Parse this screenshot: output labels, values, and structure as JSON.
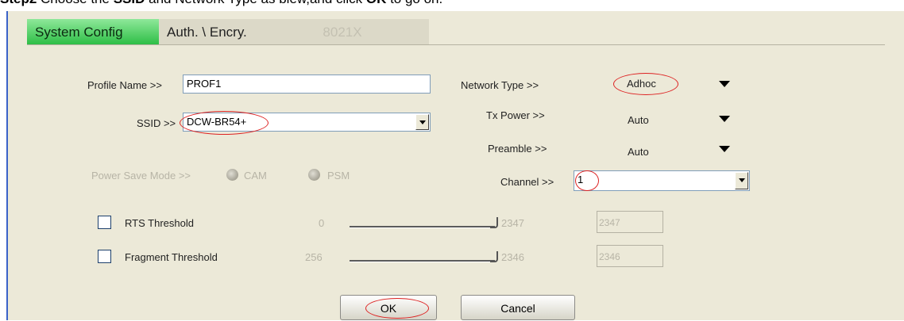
{
  "caption": {
    "step": "Step2",
    "text1": " Choose the ",
    "ssid": "SSID",
    "text2": " and Network Type as blew,and click ",
    "ok": "OK",
    "text3": " to go on."
  },
  "tabs": [
    {
      "label": "System Config",
      "active": true
    },
    {
      "label": "Auth. \\ Encry.",
      "active": false
    },
    {
      "label": "8021X",
      "active": false
    }
  ],
  "profile": {
    "label": "Profile Name >>",
    "value": "PROF1"
  },
  "ssid": {
    "label": "SSID >>",
    "value": "DCW-BR54+"
  },
  "network_type": {
    "label": "Network Type >>",
    "value": "Adhoc"
  },
  "tx_power": {
    "label": "Tx Power >>",
    "value": "Auto"
  },
  "preamble": {
    "label": "Preamble >>",
    "value": "Auto"
  },
  "channel": {
    "label": "Channel >>",
    "value": "1"
  },
  "power_save": {
    "label": "Power Save Mode >>",
    "cam": "CAM",
    "psm": "PSM"
  },
  "rts": {
    "label": "RTS Threshold",
    "min": "0",
    "max": "2347",
    "value": "2347"
  },
  "fragment": {
    "label": "Fragment Threshold",
    "min": "256",
    "max": "2346",
    "value": "2346"
  },
  "buttons": {
    "ok": "OK",
    "cancel": "Cancel"
  },
  "colors": {
    "accent_tab": "#2bbd44",
    "highlight": "#dd2222",
    "window_bg": "#ece9d8"
  }
}
